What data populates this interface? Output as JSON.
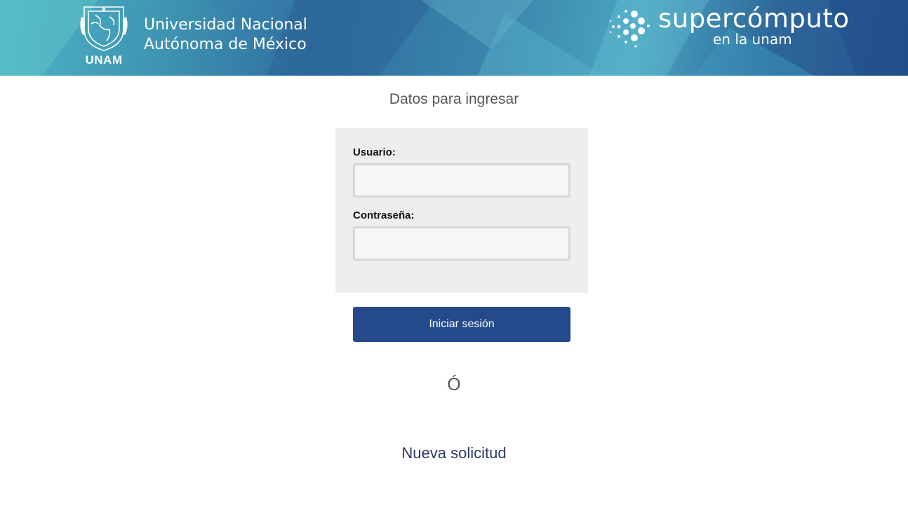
{
  "header": {
    "university_line1": "Universidad Nacional",
    "university_line2": "Autónoma de México",
    "unam_acronym": "UNAM",
    "brand_title": "supercómputo",
    "brand_subtitle": "en la unam"
  },
  "main": {
    "heading": "Datos para ingresar",
    "username_label": "Usuario:",
    "username_value": "",
    "password_label": "Contraseña:",
    "password_value": "",
    "login_button": "Iniciar sesión",
    "or_text": "Ó",
    "new_request_link": "Nueva solicitud"
  },
  "colors": {
    "header_dark": "#24548f",
    "header_light": "#4fb6c4",
    "button_bg": "#244a8b",
    "panel_bg": "#eeeeee",
    "link_color": "#2a3a66"
  },
  "icons": {
    "unam_crest": "unam-crest-icon",
    "supercomputo_dots": "supercomputo-dots-icon"
  }
}
